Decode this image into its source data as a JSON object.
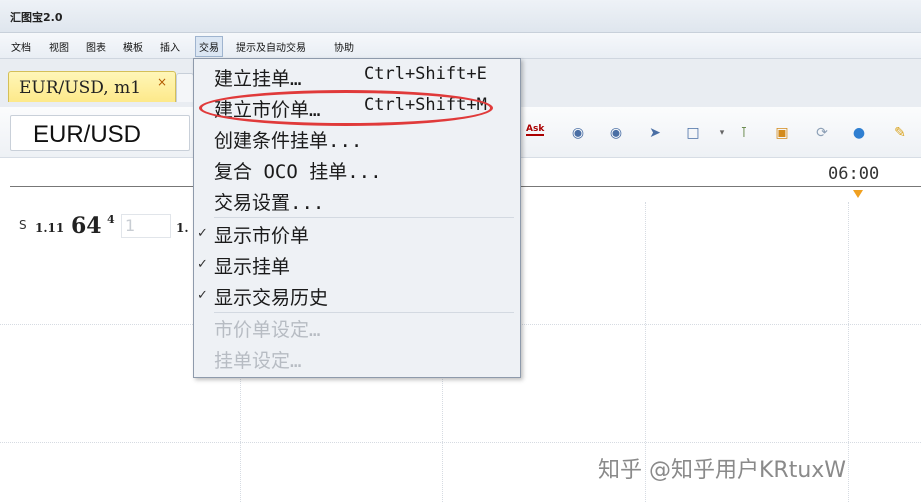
{
  "app": {
    "title": "汇图宝2.0"
  },
  "menubar": {
    "items": [
      {
        "label": "文档"
      },
      {
        "label": "视图"
      },
      {
        "label": "图表"
      },
      {
        "label": "模板"
      },
      {
        "label": "插入"
      },
      {
        "label": "交易"
      },
      {
        "label": "提示及自动交易"
      },
      {
        "label": "协助"
      }
    ]
  },
  "tabs": [
    {
      "label": "EUR/USD, m1",
      "close": "×"
    }
  ],
  "toolbar": {
    "symbol": "EUR/USD",
    "ask_label": "Ask"
  },
  "chart": {
    "time_label": "06:00"
  },
  "quote": {
    "side": "S",
    "prefix": "1.11",
    "big": "64",
    "sup": "4",
    "input_value": "1",
    "suffix": "1."
  },
  "trade_menu": {
    "items": [
      {
        "label": "建立挂单…",
        "shortcut": "Ctrl+Shift+E",
        "checked": false,
        "enabled": true
      },
      {
        "label": "建立市价单…",
        "shortcut": "Ctrl+Shift+M",
        "checked": false,
        "enabled": true
      },
      {
        "label": "创建条件挂单...",
        "shortcut": "",
        "checked": false,
        "enabled": true
      },
      {
        "label": "复合 OCO 挂单...",
        "shortcut": "",
        "checked": false,
        "enabled": true
      },
      {
        "label": "交易设置...",
        "shortcut": "",
        "checked": false,
        "enabled": true
      },
      {
        "label": "显示市价单",
        "shortcut": "",
        "checked": true,
        "enabled": true
      },
      {
        "label": "显示挂单",
        "shortcut": "",
        "checked": true,
        "enabled": true
      },
      {
        "label": "显示交易历史",
        "shortcut": "",
        "checked": true,
        "enabled": true
      },
      {
        "label": "市价单设定…",
        "shortcut": "",
        "checked": false,
        "enabled": false
      },
      {
        "label": "挂单设定…",
        "shortcut": "",
        "checked": false,
        "enabled": false
      }
    ],
    "check_glyph": "✓"
  },
  "watermark": "知乎 @知乎用户KRtuxW",
  "colors": {
    "tab_active": "#fde98a",
    "highlight_ring": "#e03a3a",
    "ask_red": "#aa0000"
  }
}
